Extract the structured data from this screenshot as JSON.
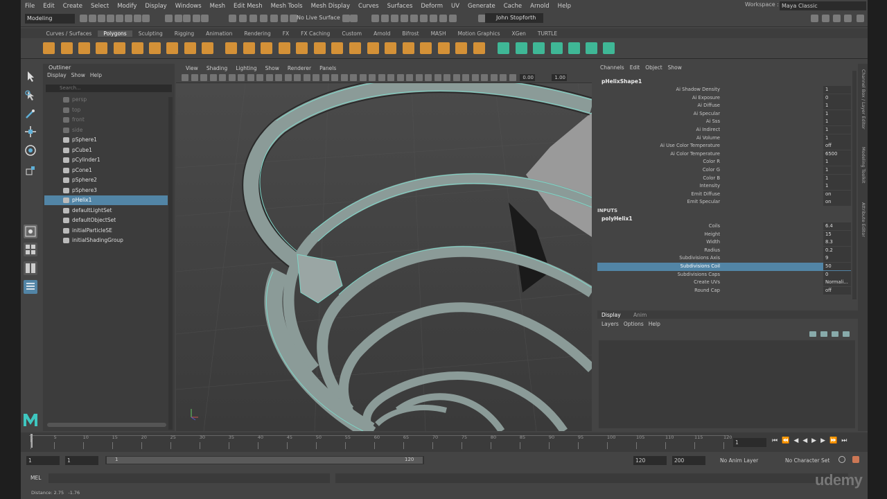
{
  "menubar": [
    "File",
    "Edit",
    "Create",
    "Select",
    "Modify",
    "Display",
    "Windows",
    "Mesh",
    "Edit Mesh",
    "Mesh Tools",
    "Mesh Display",
    "Curves",
    "Surfaces",
    "Deform",
    "UV",
    "Generate",
    "Cache",
    "Arnold",
    "Help"
  ],
  "workspace": {
    "label": "Workspace :",
    "value": "Maya Classic"
  },
  "status": {
    "mode": "Modeling",
    "live_surface": "No Live Surface",
    "user": "John Stopforth"
  },
  "shelf_tabs": [
    "Curves / Surfaces",
    "Polygons",
    "Sculpting",
    "Rigging",
    "Animation",
    "Rendering",
    "FX",
    "FX Caching",
    "Custom",
    "Arnold",
    "Bifrost",
    "MASH",
    "Motion Graphics",
    "XGen",
    "TURTLE"
  ],
  "shelf_active": "Polygons",
  "outliner": {
    "title": "Outliner",
    "menu": [
      "Display",
      "Show",
      "Help"
    ],
    "search_placeholder": "Search...",
    "items": [
      {
        "label": "persp",
        "dim": true
      },
      {
        "label": "top",
        "dim": true
      },
      {
        "label": "front",
        "dim": true
      },
      {
        "label": "side",
        "dim": true
      },
      {
        "label": "pSphere1",
        "dim": false
      },
      {
        "label": "pCube1",
        "dim": false
      },
      {
        "label": "pCylinder1",
        "dim": false
      },
      {
        "label": "pCone1",
        "dim": false
      },
      {
        "label": "pSphere2",
        "dim": false
      },
      {
        "label": "pSphere3",
        "dim": false
      },
      {
        "label": "pHelix1",
        "dim": false,
        "selected": true
      },
      {
        "label": "defaultLightSet",
        "dim": false
      },
      {
        "label": "defaultObjectSet",
        "dim": false
      },
      {
        "label": "initialParticleSE",
        "dim": false
      },
      {
        "label": "initialShadingGroup",
        "dim": false
      }
    ]
  },
  "viewport": {
    "menu": [
      "View",
      "Shading",
      "Lighting",
      "Show",
      "Renderer",
      "Panels"
    ],
    "near": "0.00",
    "far": "1.00"
  },
  "channelbox": {
    "menu": [
      "Channels",
      "Edit",
      "Object",
      "Show"
    ],
    "shape_name": "pHelixShape1",
    "shape_attrs": [
      {
        "label": "Ai Shadow Density",
        "value": "1"
      },
      {
        "label": "Ai Exposure",
        "value": "0"
      },
      {
        "label": "Ai Diffuse",
        "value": "1"
      },
      {
        "label": "Ai Specular",
        "value": "1"
      },
      {
        "label": "Ai Sss",
        "value": "1"
      },
      {
        "label": "Ai Indirect",
        "value": "1"
      },
      {
        "label": "Ai Volume",
        "value": "1"
      },
      {
        "label": "Ai Use Color Temperature",
        "value": "off"
      },
      {
        "label": "Ai Color Temperature",
        "value": "6500"
      },
      {
        "label": "Color R",
        "value": "1"
      },
      {
        "label": "Color G",
        "value": "1"
      },
      {
        "label": "Color B",
        "value": "1"
      },
      {
        "label": "Intensity",
        "value": "1"
      },
      {
        "label": "Emit Diffuse",
        "value": "on"
      },
      {
        "label": "Emit Specular",
        "value": "on"
      }
    ],
    "inputs_header": "INPUTS",
    "input_name": "polyHelix1",
    "input_attrs": [
      {
        "label": "Coils",
        "value": "6.4"
      },
      {
        "label": "Height",
        "value": "15"
      },
      {
        "label": "Width",
        "value": "8.3"
      },
      {
        "label": "Radius",
        "value": "0.2"
      },
      {
        "label": "Subdivisions Axis",
        "value": "9"
      },
      {
        "label": "Subdivisions Coil",
        "value": "50",
        "selected": true
      },
      {
        "label": "Subdivisions Caps",
        "value": "0"
      },
      {
        "label": "Create UVs",
        "value": "Normali..."
      },
      {
        "label": "Round Cap",
        "value": "off"
      }
    ],
    "side_tabs": [
      "Channel Box / Layer Editor",
      "Modeling Toolkit",
      "Attribute Editor"
    ]
  },
  "layer_editor": {
    "tabs": [
      "Display",
      "Anim"
    ],
    "menu": [
      "Layers",
      "Options",
      "Help"
    ]
  },
  "timeline": {
    "ticks": [
      "1",
      "5",
      "10",
      "15",
      "20",
      "25",
      "30",
      "35",
      "40",
      "45",
      "50",
      "55",
      "60",
      "65",
      "70",
      "75",
      "80",
      "85",
      "90",
      "95",
      "100",
      "105",
      "110",
      "115",
      "120"
    ],
    "current_frame": "1"
  },
  "range": {
    "start": "1",
    "start2": "1",
    "range_start": "1",
    "range_end": "120",
    "end": "120",
    "end2": "200",
    "anim_layer": "No Anim Layer",
    "char_set": "No Character Set"
  },
  "cmdline": {
    "label": "MEL"
  },
  "helpline": {
    "text": "Distance: 2.75   -1.76"
  },
  "watermark": "udemy",
  "colors": {
    "accent": "#5285a6",
    "wire": "#7fd6c8"
  }
}
